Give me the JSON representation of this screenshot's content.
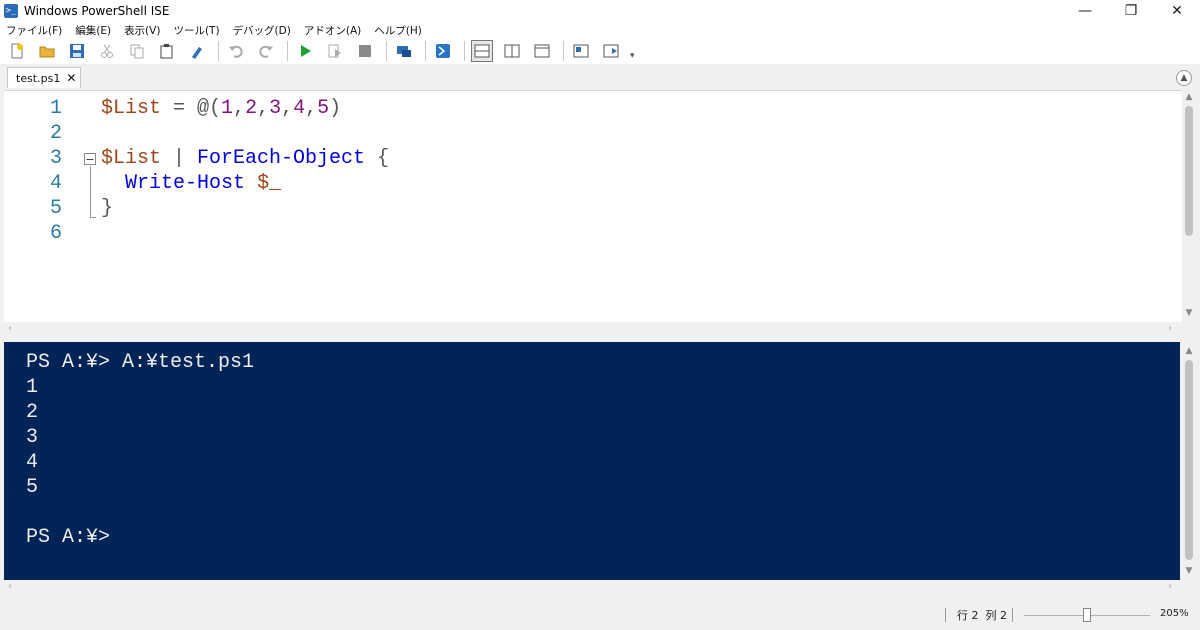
{
  "window": {
    "title": "Windows PowerShell ISE",
    "icon_glyph": ">_",
    "minimize_glyph": "—",
    "restore_glyph": "❐",
    "close_glyph": "✕"
  },
  "menu": [
    "ファイル(F)",
    "編集(E)",
    "表示(V)",
    "ツール(T)",
    "デバッグ(D)",
    "アドオン(A)",
    "ヘルプ(H)"
  ],
  "toolbar_icons": [
    "new-file-icon",
    "open-folder-icon",
    "save-icon",
    "cut-icon",
    "copy-icon",
    "paste-icon",
    "clear-console-icon",
    "undo-icon",
    "redo-icon",
    "run-script-icon",
    "run-selection-icon",
    "stop-icon",
    "new-remote-tab-icon",
    "start-powershell-icon",
    "layout-top-icon",
    "layout-right-icon",
    "layout-max-icon",
    "show-script-pane-icon",
    "show-commands-icon"
  ],
  "tab": {
    "label": "test.ps1",
    "close_glyph": "✕"
  },
  "editor": {
    "line_numbers": [
      "1",
      "2",
      "3",
      "4",
      "5",
      "6"
    ],
    "lines": [
      [
        {
          "t": "$List",
          "c": "var"
        },
        {
          "t": " = @(",
          "c": "op"
        },
        {
          "t": "1",
          "c": "num"
        },
        {
          "t": ",",
          "c": "op"
        },
        {
          "t": "2",
          "c": "num"
        },
        {
          "t": ",",
          "c": "op"
        },
        {
          "t": "3",
          "c": "num"
        },
        {
          "t": ",",
          "c": "op"
        },
        {
          "t": "4",
          "c": "num"
        },
        {
          "t": ",",
          "c": "op"
        },
        {
          "t": "5",
          "c": "num"
        },
        {
          "t": ")",
          "c": "op"
        }
      ],
      [],
      [
        {
          "t": "$List",
          "c": "var"
        },
        {
          "t": " | ",
          "c": "op"
        },
        {
          "t": "ForEach-Object",
          "c": "cmd"
        },
        {
          "t": " {",
          "c": "op"
        }
      ],
      [
        {
          "t": "  ",
          "c": "op"
        },
        {
          "t": "Write-Host",
          "c": "cmd"
        },
        {
          "t": " ",
          "c": "op"
        },
        {
          "t": "$_",
          "c": "var"
        }
      ],
      [
        {
          "t": "}",
          "c": "op"
        }
      ],
      []
    ],
    "fold_glyph": "−"
  },
  "console": {
    "lines": [
      "PS A:¥> A:¥test.ps1",
      "1",
      "2",
      "3",
      "4",
      "5",
      "",
      "PS A:¥>"
    ]
  },
  "status": {
    "position": "行 2  列 2",
    "zoom": "205%"
  },
  "colors": {
    "console_bg": "#012456",
    "variable": "#a0451b",
    "number": "#80137f",
    "command": "#0000e0",
    "line_number": "#2b7ca0"
  }
}
